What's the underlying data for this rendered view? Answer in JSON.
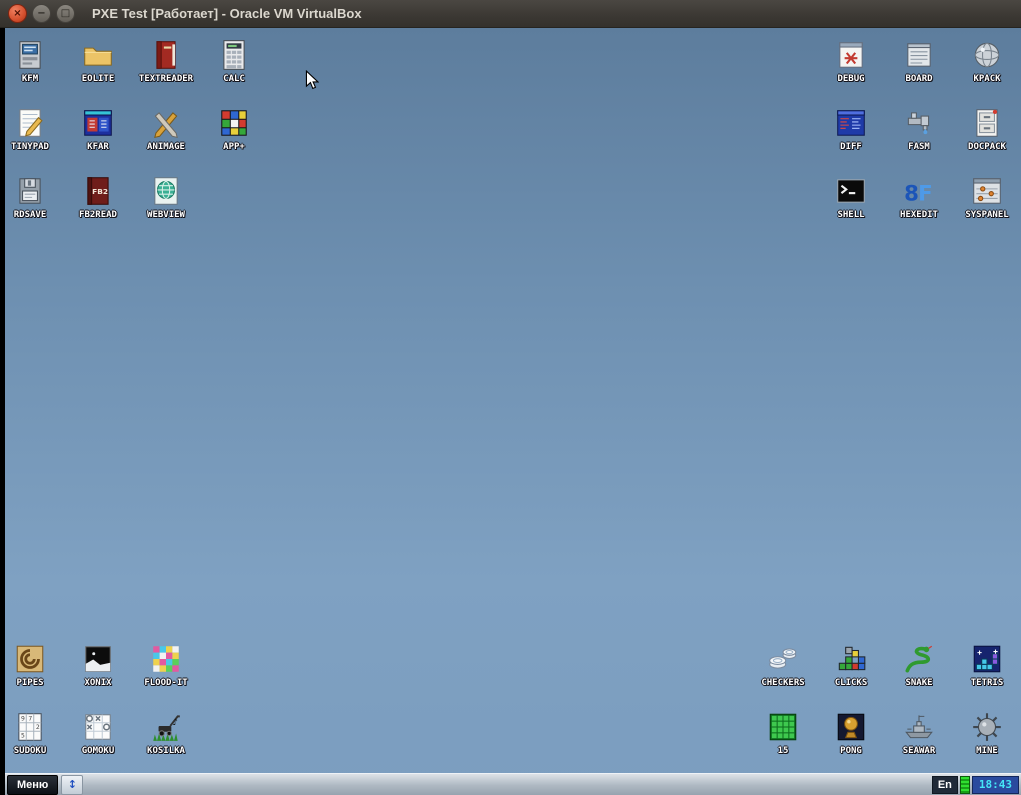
{
  "window": {
    "title": "PXE Test [Работает] - Oracle VM VirtualBox",
    "controls": {
      "close": "×",
      "minimize": "−",
      "maximize": "□"
    }
  },
  "desktop": {
    "icons": [
      {
        "label": "KFM",
        "icon": "kfm"
      },
      {
        "label": "EOLITE",
        "icon": "eolite"
      },
      {
        "label": "TEXTREADER",
        "icon": "textreader"
      },
      {
        "label": "CALC",
        "icon": "calc"
      },
      {
        "label": "TINYPAD",
        "icon": "tinypad"
      },
      {
        "label": "KFAR",
        "icon": "kfar"
      },
      {
        "label": "ANIMAGE",
        "icon": "animage"
      },
      {
        "label": "APP+",
        "icon": "appplus"
      },
      {
        "label": "RDSAVE",
        "icon": "rdsave"
      },
      {
        "label": "FB2READ",
        "icon": "fb2read"
      },
      {
        "label": "WEBVIEW",
        "icon": "webview"
      },
      {
        "label": "DEBUG",
        "icon": "debug"
      },
      {
        "label": "BOARD",
        "icon": "board"
      },
      {
        "label": "KPACK",
        "icon": "kpack"
      },
      {
        "label": "DIFF",
        "icon": "diff"
      },
      {
        "label": "FASM",
        "icon": "fasm"
      },
      {
        "label": "DOCPACK",
        "icon": "docpack"
      },
      {
        "label": "SHELL",
        "icon": "shell"
      },
      {
        "label": "HEXEDIT",
        "icon": "hexedit"
      },
      {
        "label": "SYSPANEL",
        "icon": "syspanel"
      },
      {
        "label": "PIPES",
        "icon": "pipes"
      },
      {
        "label": "XONIX",
        "icon": "xonix"
      },
      {
        "label": "FLOOD-IT",
        "icon": "floodit"
      },
      {
        "label": "SUDOKU",
        "icon": "sudoku"
      },
      {
        "label": "GOMOKU",
        "icon": "gomoku"
      },
      {
        "label": "KOSILKA",
        "icon": "kosilka"
      },
      {
        "label": "CHECKERS",
        "icon": "checkers"
      },
      {
        "label": "CLICKS",
        "icon": "clicks"
      },
      {
        "label": "SNAKE",
        "icon": "snake"
      },
      {
        "label": "TETRIS",
        "icon": "tetris"
      },
      {
        "label": "15",
        "icon": "fifteen"
      },
      {
        "label": "PONG",
        "icon": "pong"
      },
      {
        "label": "SEAWAR",
        "icon": "seawar"
      },
      {
        "label": "MINE",
        "icon": "mine"
      }
    ]
  },
  "taskbar": {
    "menu_label": "Меню",
    "updown_glyph": "↕",
    "lang": "En",
    "clock": "18:43"
  },
  "colors": {
    "desktop_top": "#5d7d9d",
    "desktop_bottom": "#7b9dbf",
    "titlebar": "#3b3833",
    "clock_text": "#45e6f6",
    "menu_button_bg": "#0c1016"
  }
}
